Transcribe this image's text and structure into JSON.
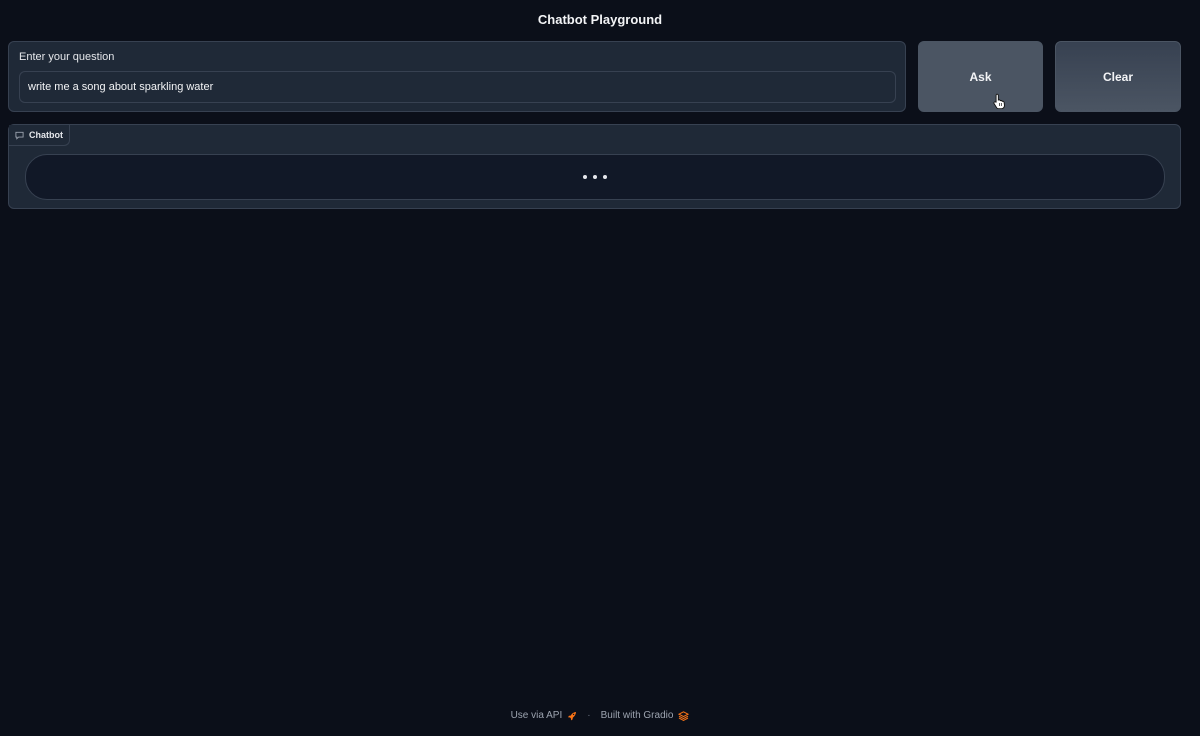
{
  "page": {
    "title": "Chatbot Playground"
  },
  "question": {
    "label": "Enter your question",
    "value": "write me a song about sparkling water",
    "placeholder": ""
  },
  "buttons": {
    "ask": "Ask",
    "clear": "Clear"
  },
  "chatbot": {
    "label": "Chatbot",
    "status": "loading"
  },
  "footer": {
    "api_link": "Use via API",
    "separator": "·",
    "built_with": "Built with Gradio"
  },
  "colors": {
    "background": "#0b0f19",
    "panel": "#1f2937",
    "border": "#374151",
    "button": "#4b5563",
    "accent": "#f97316"
  },
  "icons": {
    "chatbot": "chat-bubble-icon",
    "api": "rocket-icon",
    "gradio": "gradio-logo-icon",
    "cursor": "hand-pointer-icon"
  }
}
